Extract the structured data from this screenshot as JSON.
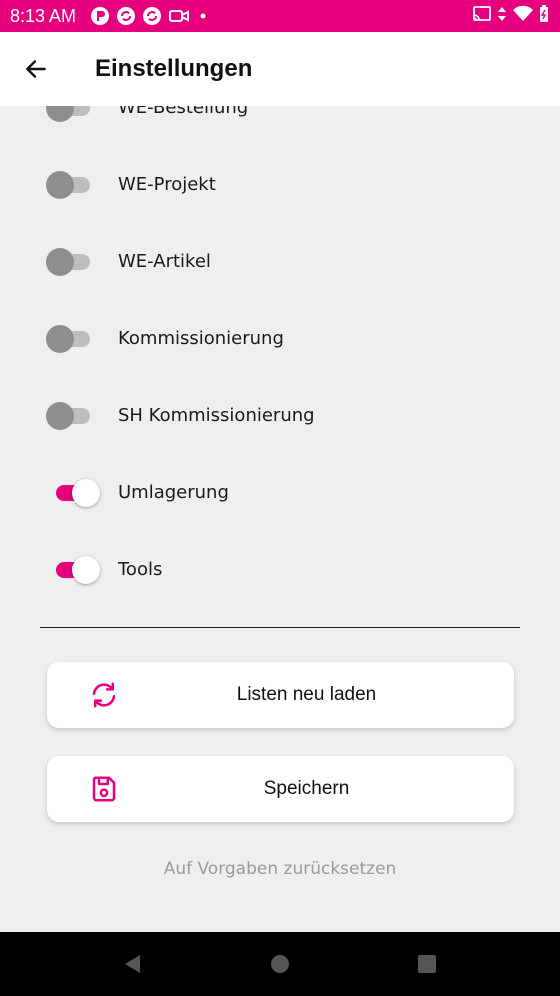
{
  "status_bar": {
    "time": "8:13 AM"
  },
  "app_bar": {
    "title": "Einstellungen"
  },
  "settings": [
    {
      "label": "WE-Bestellung",
      "on": false
    },
    {
      "label": "WE-Projekt",
      "on": false
    },
    {
      "label": "WE-Artikel",
      "on": false
    },
    {
      "label": "Kommissionierung",
      "on": false
    },
    {
      "label": "SH Kommissionierung",
      "on": false
    },
    {
      "label": "Umlagerung",
      "on": true
    },
    {
      "label": "Tools",
      "on": true
    }
  ],
  "actions": {
    "reload_label": "Listen neu laden",
    "save_label": "Speichern",
    "reset_label": "Auf Vorgaben zurücksetzen"
  },
  "colors": {
    "accent": "#e6007e",
    "switch_off_thumb": "#8e8e8e",
    "background": "#efefef"
  }
}
